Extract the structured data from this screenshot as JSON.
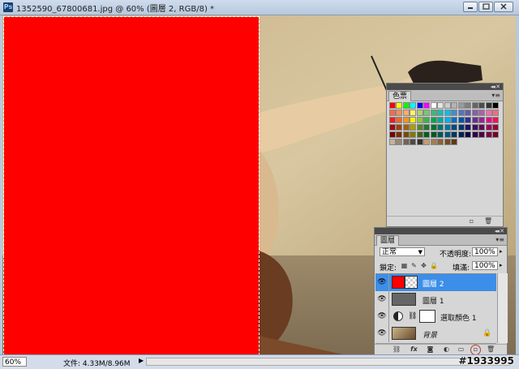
{
  "window": {
    "app_icon": "Ps",
    "title": "1352590_67800681.jpg @ 60% (圖層 2, RGB/8) *"
  },
  "swatches_panel": {
    "tab": "色票",
    "colors": [
      [
        "#ff0000",
        "#ffff00",
        "#00ff00",
        "#00ffff",
        "#0000ff",
        "#ff00ff",
        "#ffffff",
        "#e6e6e6",
        "#cccccc",
        "#b3b3b3",
        "#999999",
        "#808080",
        "#666666",
        "#4d4d4d",
        "#333333",
        "#000000"
      ],
      [
        "#f26c4f",
        "#f68e55",
        "#fbaf5c",
        "#fff467",
        "#acd372",
        "#7cc576",
        "#3bb878",
        "#1abbb4",
        "#00bff3",
        "#438ccb",
        "#5574b9",
        "#605ca8",
        "#855fa8",
        "#a763a8",
        "#f06ea9",
        "#f26d7d"
      ],
      [
        "#ed1c24",
        "#f26522",
        "#f7941d",
        "#fff200",
        "#8dc63f",
        "#39b54a",
        "#00a651",
        "#00a99d",
        "#00aeef",
        "#0072bc",
        "#0054a6",
        "#2e3192",
        "#662d91",
        "#92278f",
        "#ec008c",
        "#ed145b"
      ],
      [
        "#9e0b0f",
        "#a0410d",
        "#a36209",
        "#aba000",
        "#598527",
        "#1a7b30",
        "#007236",
        "#00746b",
        "#0076a3",
        "#004b80",
        "#003471",
        "#1b1464",
        "#440e62",
        "#630460",
        "#9e005d",
        "#9e0039"
      ],
      [
        "#790000",
        "#7b2e00",
        "#7d4900",
        "#827b00",
        "#406618",
        "#005e20",
        "#005826",
        "#005952",
        "#005b7f",
        "#003663",
        "#002157",
        "#0d004c",
        "#32004b",
        "#4b0049",
        "#7b0046",
        "#7a0026"
      ],
      [
        "#c7b299",
        "#998675",
        "#736357",
        "#534741",
        "#37302d",
        "#c69c6d",
        "#a67c52",
        "#8c6239",
        "#754c24",
        "#603913"
      ]
    ]
  },
  "layers_panel": {
    "tab": "圖層",
    "blend_mode": "正常",
    "opacity_label": "不透明度:",
    "opacity": "100%",
    "lock_label": "鎖定:",
    "fill_label": "填滿:",
    "fill": "100%",
    "layers": [
      {
        "name": "圖層 2",
        "selected": true
      },
      {
        "name": "圖層 1",
        "selected": false
      },
      {
        "name": "選取顏色 1",
        "selected": false
      },
      {
        "name": "背景",
        "selected": false
      }
    ],
    "footer_icons": [
      "link-icon",
      "fx-icon",
      "mask-icon",
      "adjustment-icon",
      "group-icon",
      "new-layer-icon",
      "trash-icon"
    ]
  },
  "status": {
    "zoom": "60%",
    "doc_info": "文件: 4.33M/8.96M",
    "watermark": "#1933995"
  },
  "colors": {
    "selected_layer": "#3d8ee8",
    "red_fill": "#ff0000",
    "panel_bg": "#d6d6d6"
  }
}
